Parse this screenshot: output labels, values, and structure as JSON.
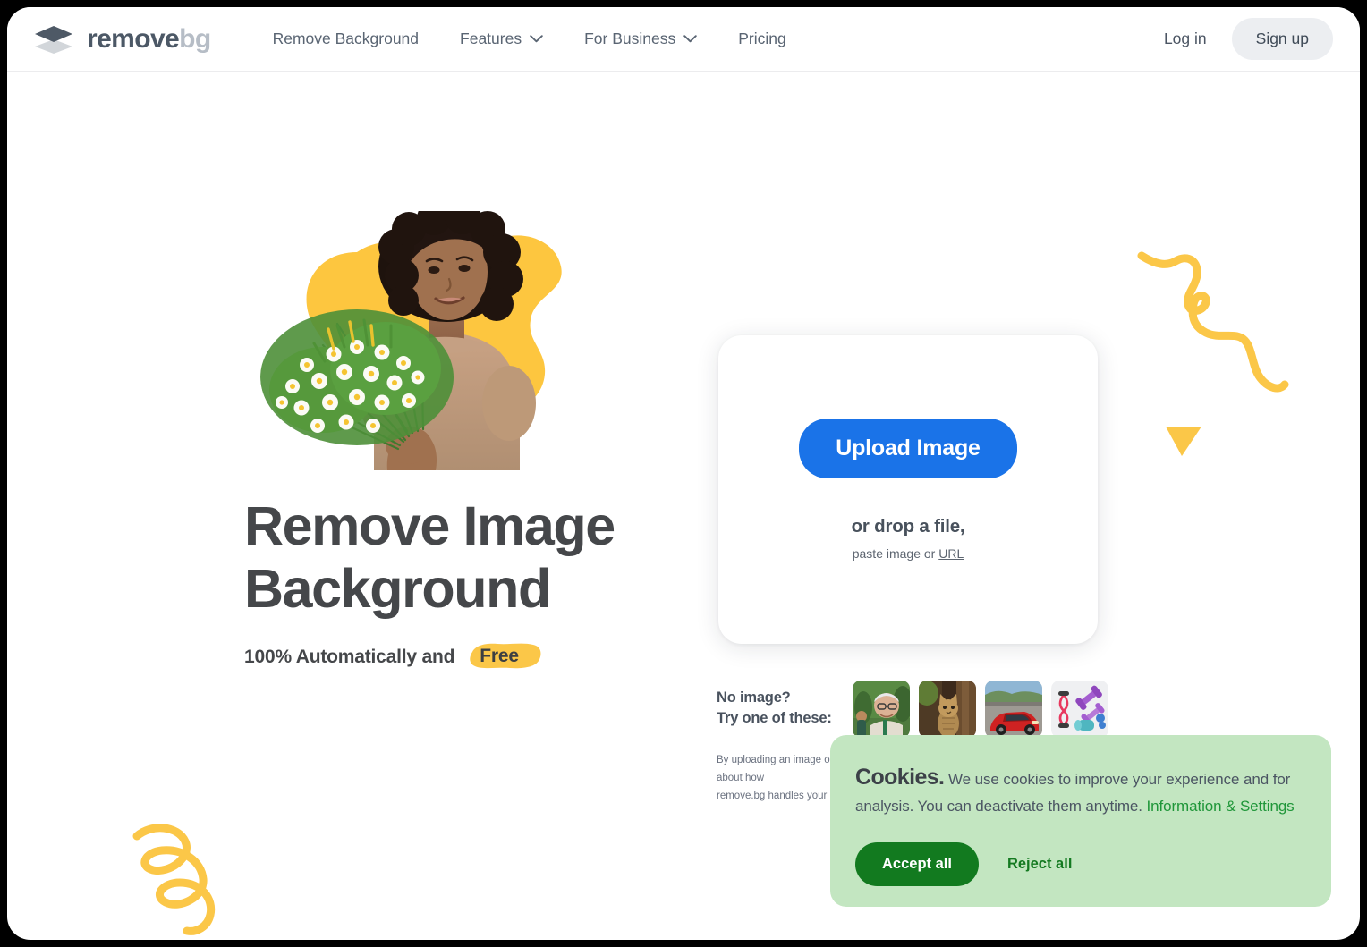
{
  "brand": {
    "name_primary": "remove",
    "name_secondary": "bg",
    "logo_icon": "stacked-layers-icon"
  },
  "header": {
    "nav": [
      {
        "label": "Remove Background",
        "has_dropdown": false
      },
      {
        "label": "Features",
        "has_dropdown": true,
        "icon": "chevron-down-icon"
      },
      {
        "label": "For Business",
        "has_dropdown": true,
        "icon": "chevron-down-icon"
      },
      {
        "label": "Pricing",
        "has_dropdown": false
      }
    ],
    "login_label": "Log in",
    "signup_label": "Sign up"
  },
  "hero": {
    "title_line1": "Remove Image",
    "title_line2": "Background",
    "subtitle_prefix": "100% Automatically and",
    "subtitle_highlight": "Free",
    "photo_alt": "woman-holding-flowers-photo",
    "blob_color": "#fdc63f"
  },
  "upload": {
    "button_label": "Upload Image",
    "drop_label": "or drop a file,",
    "paste_prefix": "paste image or ",
    "paste_link": "URL",
    "button_color": "#1a73e8"
  },
  "samples": {
    "label_line1": "No image?",
    "label_line2": "Try one of these:",
    "thumbnails": [
      {
        "name": "sample-man-portrait"
      },
      {
        "name": "sample-cat"
      },
      {
        "name": "sample-red-car"
      },
      {
        "name": "sample-fitness-equipment"
      }
    ]
  },
  "legal": {
    "line1": "By uploading an image or URL you agree to our Terms of Service. To learn more about how",
    "line2": "remove.bg handles your personal data, check our Privacy Policy."
  },
  "cookies": {
    "heading": "Cookies.",
    "body_part1": " We use cookies to improve your experience and for analysis. You can deactivate them anytime. ",
    "link_label": "Information & Settings",
    "accept_label": "Accept all",
    "reject_label": "Reject all",
    "background_color": "#c3e6c1",
    "accent_color": "#127a1f"
  },
  "decor": {
    "squiggle_right": "yellow-squiggle-icon",
    "triangle": "yellow-triangle-icon",
    "squiggle_left": "yellow-spiral-icon",
    "color": "#fbc748"
  }
}
